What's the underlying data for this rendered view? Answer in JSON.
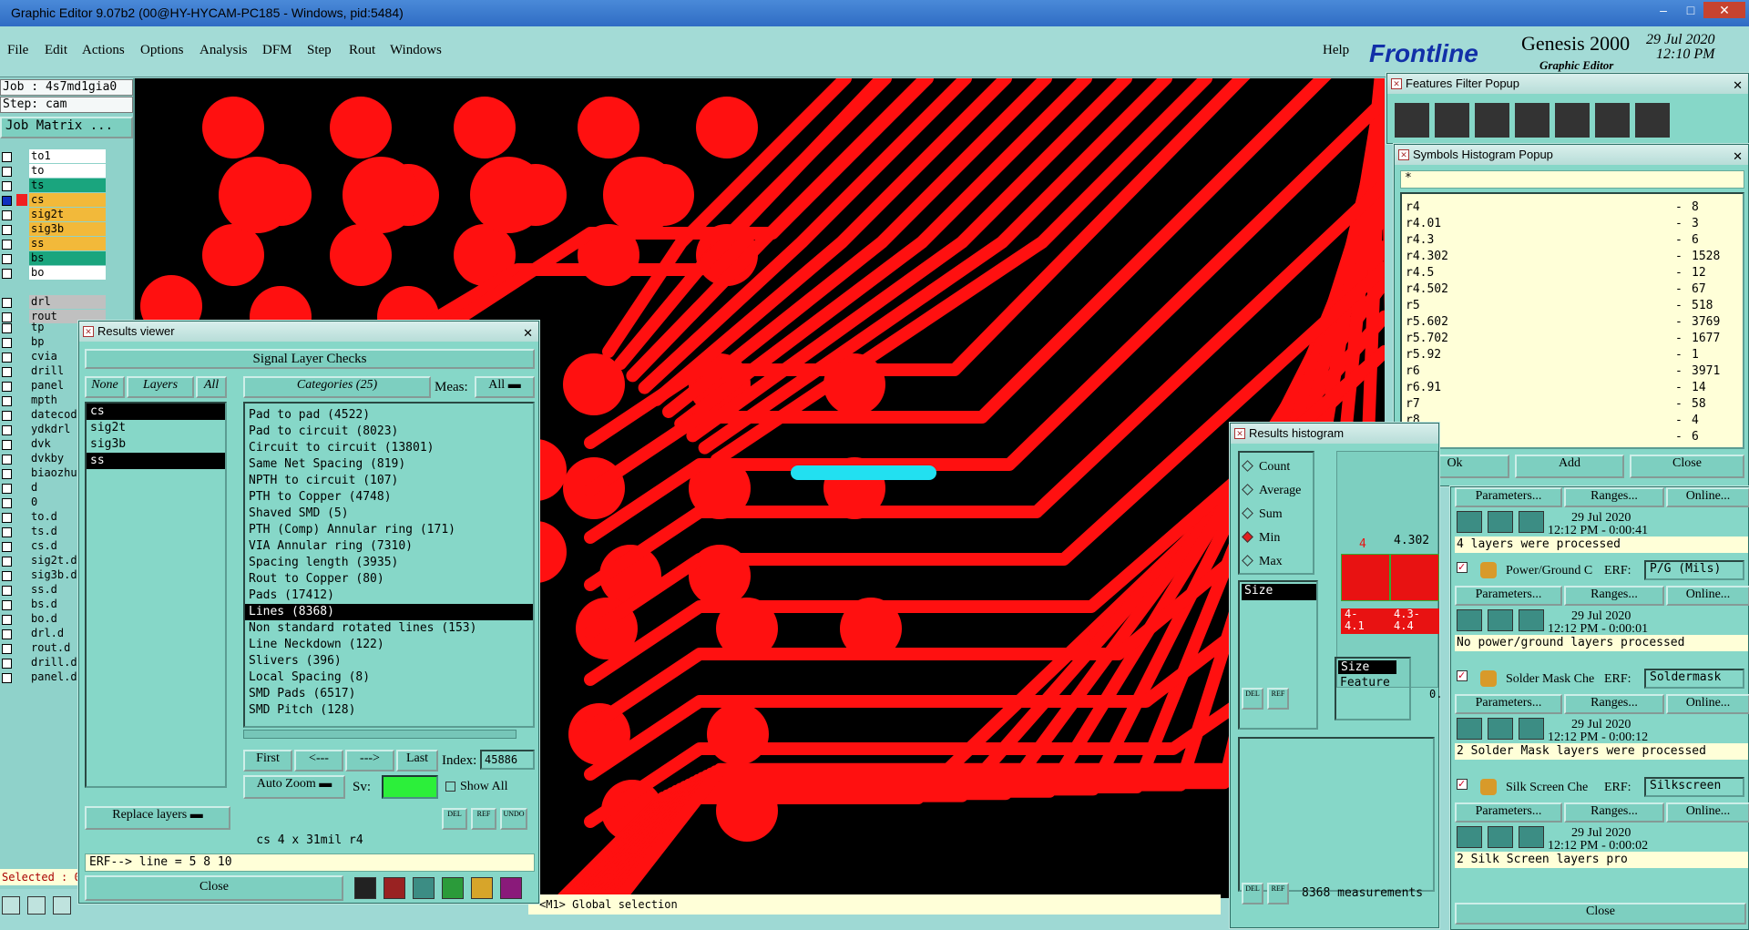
{
  "window": {
    "title": "Graphic Editor 9.07b2 (00@HY-HYCAM-PC185 - Windows, pid:5484)",
    "min": "–",
    "max": "□",
    "close": "✕"
  },
  "menu": {
    "items": [
      "File",
      "Edit",
      "Actions",
      "Options",
      "Analysis",
      "DFM",
      "Step",
      "Rout",
      "Windows"
    ],
    "help": "Help"
  },
  "brand": {
    "logo": "Frontline",
    "product": "Genesis 2000",
    "subtitle": "Graphic Editor",
    "date": "29 Jul 2020",
    "time": "12:10 PM"
  },
  "left": {
    "job": "Job : 4s7md1gia0",
    "step": "Step: cam",
    "job_matrix": "Job Matrix ...",
    "layers_top": [
      {
        "name": "to1",
        "color": "#ffffff",
        "mark": false
      },
      {
        "name": "to",
        "color": "#ffffff",
        "mark": true
      },
      {
        "name": "ts",
        "color": "#1aa57e",
        "mark": false
      },
      {
        "name": "cs",
        "color": "#f2b93a",
        "mark": true,
        "active": true
      },
      {
        "name": "sig2t",
        "color": "#f2b93a",
        "mark": false
      },
      {
        "name": "sig3b",
        "color": "#f2b93a",
        "mark": false
      },
      {
        "name": "ss",
        "color": "#f2b93a",
        "mark": true
      },
      {
        "name": "bs",
        "color": "#1aa57e",
        "mark": false
      },
      {
        "name": "bo",
        "color": "#ffffff",
        "mark": true
      }
    ],
    "layers_mid": [
      {
        "name": "drl",
        "color": "#c0c0c0"
      },
      {
        "name": "rout",
        "color": "#c0c0c0"
      }
    ],
    "layers_bottom": [
      "tp",
      "bp",
      "cvia",
      "drill",
      "panel",
      "mpth",
      "datecod",
      "ydkdrl",
      "dvk",
      "dvkby",
      "biaozhu",
      "d",
      "0",
      "to.d",
      "ts.d",
      "cs.d",
      "sig2t.d",
      "sig3b.d",
      "ss.d",
      "bs.d",
      "bo.d",
      "drl.d",
      "rout.d",
      "drill.d",
      "panel.d"
    ],
    "selected": "Selected : 0"
  },
  "status": {
    "message": "<M1> Global selection"
  },
  "results_viewer": {
    "title": "Results viewer",
    "header": "Signal Layer Checks",
    "none": "None",
    "layers": "Layers",
    "all": "All",
    "layer_list": [
      {
        "name": "cs",
        "selected": true
      },
      {
        "name": "sig2t",
        "selected": false
      },
      {
        "name": "sig3b",
        "selected": false
      },
      {
        "name": "ss",
        "selected": true
      }
    ],
    "categories_label": "Categories (25)",
    "meas_label": "Meas:",
    "meas_value": "All",
    "categories": [
      "Pad to pad (4522)",
      "Pad to circuit (8023)",
      "Circuit to circuit (13801)",
      "Same Net Spacing (819)",
      "NPTH to circuit (107)",
      "PTH to Copper (4748)",
      "Shaved SMD (5)",
      "PTH (Comp) Annular ring (171)",
      "VIA Annular ring (7310)",
      "Spacing length (3935)",
      "Rout to Copper (80)",
      "Pads (17412)",
      "Lines (8368)",
      "Non standard rotated lines (153)",
      "Line Neckdown (122)",
      "Slivers (396)",
      "Local Spacing (8)",
      "SMD Pads (6517)",
      "SMD Pitch (128)"
    ],
    "selected_category": 12,
    "first": "First",
    "prev": "<---",
    "next": "--->",
    "last": "Last",
    "index_label": "Index:",
    "index_value": "45886",
    "auto_zoom": "Auto Zoom",
    "sv_label": "Sv:",
    "show_all": "Show All",
    "replace_layers": "Replace layers",
    "del": "DEL",
    "ref": "REF",
    "undo": "UNDO",
    "info": "cs 4 x 31mil  r4",
    "erf": "ERF--> line = 5 8 10",
    "close": "Close"
  },
  "features_filter": {
    "title": "Features Filter Popup"
  },
  "symbols_histogram": {
    "title": "Symbols Histogram Popup",
    "filter": "*",
    "rows": [
      {
        "sym": "r4",
        "count": "8"
      },
      {
        "sym": "r4.01",
        "count": "3"
      },
      {
        "sym": "r4.3",
        "count": "6"
      },
      {
        "sym": "r4.302",
        "count": "1528"
      },
      {
        "sym": "r4.5",
        "count": "12"
      },
      {
        "sym": "r4.502",
        "count": "67"
      },
      {
        "sym": "r5",
        "count": "518"
      },
      {
        "sym": "r5.602",
        "count": "3769"
      },
      {
        "sym": "r5.702",
        "count": "1677"
      },
      {
        "sym": "r5.92",
        "count": "1"
      },
      {
        "sym": "r6",
        "count": "3971"
      },
      {
        "sym": "r6.91",
        "count": "14"
      },
      {
        "sym": "r7",
        "count": "58"
      },
      {
        "sym": "r8",
        "count": "4"
      },
      {
        "sym": "r8.3",
        "count": "6"
      }
    ],
    "ok": "Ok",
    "add": "Add",
    "close": "Close"
  },
  "results_histogram": {
    "title": "Results histogram",
    "options": [
      "Count",
      "Average",
      "Sum",
      "Min",
      "Max"
    ],
    "selected_option": 3,
    "size": "Size",
    "bar_top_left": "4",
    "bar_top_right": "4.302",
    "bin1": "4-\n4.1",
    "bin2": "4.3-\n4.4",
    "size2": "Size",
    "feature": "Feature",
    "zero": "0.",
    "measurements": "8368 measurements"
  },
  "checklist": {
    "params": "Parameters...",
    "ranges": "Ranges...",
    "online": "Online...",
    "groups": [
      {
        "date": "29 Jul 2020",
        "time": "12:12 PM - 0:00:41",
        "msg": "4 layers were processed"
      },
      {
        "name": "Power/Ground C",
        "erf": "ERF:",
        "erf_value": "P/G (Mils)",
        "date": "29 Jul 2020",
        "time": "12:12 PM - 0:00:01",
        "msg": "No power/ground layers processed"
      },
      {
        "name": "Solder Mask Che",
        "erf": "ERF:",
        "erf_value": "Soldermask",
        "date": "29 Jul 2020",
        "time": "12:12 PM - 0:00:12",
        "msg": "2 Solder Mask layers were processed"
      },
      {
        "name": "Silk Screen Che",
        "erf": "ERF:",
        "erf_value": "Silkscreen",
        "date": "29 Jul 2020",
        "time": "12:12 PM - 0:00:02",
        "msg": "2 Silk Screen layers pro"
      }
    ],
    "close": "Close"
  },
  "colors": {
    "copper": "#ff1010",
    "highlight": "#22e0f0",
    "panel": "#86d7c8"
  }
}
